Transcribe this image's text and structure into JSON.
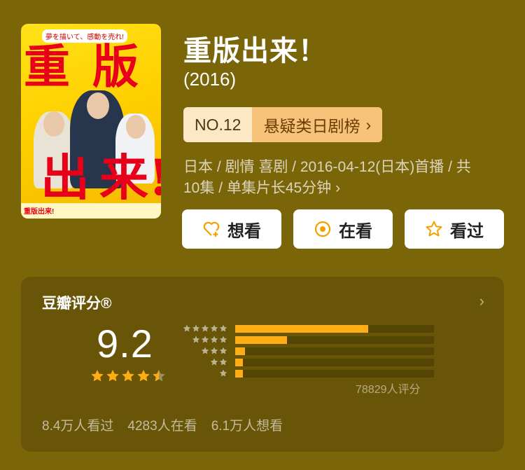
{
  "poster": {
    "tagline": "夢を描いて、感動を売れ!",
    "title_chars": [
      "重",
      "版",
      "出",
      "来!"
    ],
    "footer_logo": "重版出来!"
  },
  "title": "重版出来！",
  "year": "(2016)",
  "ranking": {
    "number": "NO.12",
    "list_name": "悬疑类日剧榜",
    "arrow": "›"
  },
  "meta_line1": "日本 / 剧情 喜剧 / 2016-04-12(日本)首播 / 共",
  "meta_line2": "10集 / 单集片长45分钟",
  "meta_arrow": "›",
  "actions": {
    "want": {
      "label": "想看",
      "icon": "heart-plus-icon"
    },
    "watching": {
      "label": "在看",
      "icon": "target-circle-icon"
    },
    "watched": {
      "label": "看过",
      "icon": "star-outline-icon"
    }
  },
  "rating": {
    "header": "豆瓣评分®",
    "chevron": "›",
    "score": "9.2",
    "stars_value": 4.5,
    "count_text": "78829人评分",
    "distribution": [
      {
        "stars": 5,
        "fraction": 0.67
      },
      {
        "stars": 4,
        "fraction": 0.26
      },
      {
        "stars": 3,
        "fraction": 0.05
      },
      {
        "stars": 2,
        "fraction": 0.04
      },
      {
        "stars": 1,
        "fraction": 0.04
      }
    ]
  },
  "stats": {
    "watched": "8.4万人看过",
    "watching": "4283人在看",
    "want": "6.1万人想看"
  },
  "colors": {
    "background": "#7b6509",
    "card": "#685507",
    "accent": "#ffad14",
    "rank_bg": "#fde8c6",
    "rank_name_bg": "#f7c27a"
  }
}
